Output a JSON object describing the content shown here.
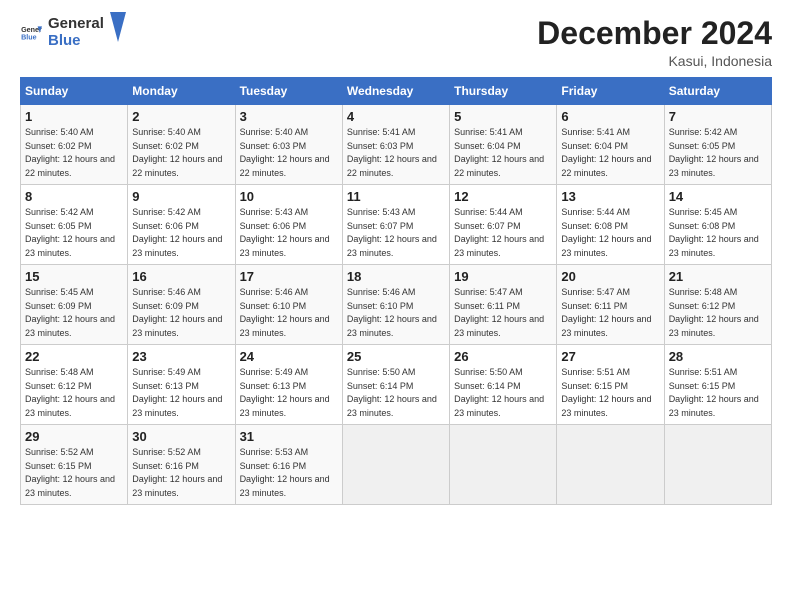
{
  "header": {
    "logo_general": "General",
    "logo_blue": "Blue",
    "title": "December 2024",
    "subtitle": "Kasui, Indonesia"
  },
  "calendar": {
    "days_of_week": [
      "Sunday",
      "Monday",
      "Tuesday",
      "Wednesday",
      "Thursday",
      "Friday",
      "Saturday"
    ],
    "weeks": [
      [
        {
          "day": "",
          "info": ""
        },
        {
          "day": "2",
          "sunrise": "Sunrise: 5:40 AM",
          "sunset": "Sunset: 6:02 PM",
          "daylight": "Daylight: 12 hours and 22 minutes."
        },
        {
          "day": "3",
          "sunrise": "Sunrise: 5:40 AM",
          "sunset": "Sunset: 6:03 PM",
          "daylight": "Daylight: 12 hours and 22 minutes."
        },
        {
          "day": "4",
          "sunrise": "Sunrise: 5:41 AM",
          "sunset": "Sunset: 6:03 PM",
          "daylight": "Daylight: 12 hours and 22 minutes."
        },
        {
          "day": "5",
          "sunrise": "Sunrise: 5:41 AM",
          "sunset": "Sunset: 6:04 PM",
          "daylight": "Daylight: 12 hours and 22 minutes."
        },
        {
          "day": "6",
          "sunrise": "Sunrise: 5:41 AM",
          "sunset": "Sunset: 6:04 PM",
          "daylight": "Daylight: 12 hours and 22 minutes."
        },
        {
          "day": "7",
          "sunrise": "Sunrise: 5:42 AM",
          "sunset": "Sunset: 6:05 PM",
          "daylight": "Daylight: 12 hours and 23 minutes."
        }
      ],
      [
        {
          "day": "8",
          "sunrise": "Sunrise: 5:42 AM",
          "sunset": "Sunset: 6:05 PM",
          "daylight": "Daylight: 12 hours and 23 minutes."
        },
        {
          "day": "9",
          "sunrise": "Sunrise: 5:42 AM",
          "sunset": "Sunset: 6:06 PM",
          "daylight": "Daylight: 12 hours and 23 minutes."
        },
        {
          "day": "10",
          "sunrise": "Sunrise: 5:43 AM",
          "sunset": "Sunset: 6:06 PM",
          "daylight": "Daylight: 12 hours and 23 minutes."
        },
        {
          "day": "11",
          "sunrise": "Sunrise: 5:43 AM",
          "sunset": "Sunset: 6:07 PM",
          "daylight": "Daylight: 12 hours and 23 minutes."
        },
        {
          "day": "12",
          "sunrise": "Sunrise: 5:44 AM",
          "sunset": "Sunset: 6:07 PM",
          "daylight": "Daylight: 12 hours and 23 minutes."
        },
        {
          "day": "13",
          "sunrise": "Sunrise: 5:44 AM",
          "sunset": "Sunset: 6:08 PM",
          "daylight": "Daylight: 12 hours and 23 minutes."
        },
        {
          "day": "14",
          "sunrise": "Sunrise: 5:45 AM",
          "sunset": "Sunset: 6:08 PM",
          "daylight": "Daylight: 12 hours and 23 minutes."
        }
      ],
      [
        {
          "day": "15",
          "sunrise": "Sunrise: 5:45 AM",
          "sunset": "Sunset: 6:09 PM",
          "daylight": "Daylight: 12 hours and 23 minutes."
        },
        {
          "day": "16",
          "sunrise": "Sunrise: 5:46 AM",
          "sunset": "Sunset: 6:09 PM",
          "daylight": "Daylight: 12 hours and 23 minutes."
        },
        {
          "day": "17",
          "sunrise": "Sunrise: 5:46 AM",
          "sunset": "Sunset: 6:10 PM",
          "daylight": "Daylight: 12 hours and 23 minutes."
        },
        {
          "day": "18",
          "sunrise": "Sunrise: 5:46 AM",
          "sunset": "Sunset: 6:10 PM",
          "daylight": "Daylight: 12 hours and 23 minutes."
        },
        {
          "day": "19",
          "sunrise": "Sunrise: 5:47 AM",
          "sunset": "Sunset: 6:11 PM",
          "daylight": "Daylight: 12 hours and 23 minutes."
        },
        {
          "day": "20",
          "sunrise": "Sunrise: 5:47 AM",
          "sunset": "Sunset: 6:11 PM",
          "daylight": "Daylight: 12 hours and 23 minutes."
        },
        {
          "day": "21",
          "sunrise": "Sunrise: 5:48 AM",
          "sunset": "Sunset: 6:12 PM",
          "daylight": "Daylight: 12 hours and 23 minutes."
        }
      ],
      [
        {
          "day": "22",
          "sunrise": "Sunrise: 5:48 AM",
          "sunset": "Sunset: 6:12 PM",
          "daylight": "Daylight: 12 hours and 23 minutes."
        },
        {
          "day": "23",
          "sunrise": "Sunrise: 5:49 AM",
          "sunset": "Sunset: 6:13 PM",
          "daylight": "Daylight: 12 hours and 23 minutes."
        },
        {
          "day": "24",
          "sunrise": "Sunrise: 5:49 AM",
          "sunset": "Sunset: 6:13 PM",
          "daylight": "Daylight: 12 hours and 23 minutes."
        },
        {
          "day": "25",
          "sunrise": "Sunrise: 5:50 AM",
          "sunset": "Sunset: 6:14 PM",
          "daylight": "Daylight: 12 hours and 23 minutes."
        },
        {
          "day": "26",
          "sunrise": "Sunrise: 5:50 AM",
          "sunset": "Sunset: 6:14 PM",
          "daylight": "Daylight: 12 hours and 23 minutes."
        },
        {
          "day": "27",
          "sunrise": "Sunrise: 5:51 AM",
          "sunset": "Sunset: 6:15 PM",
          "daylight": "Daylight: 12 hours and 23 minutes."
        },
        {
          "day": "28",
          "sunrise": "Sunrise: 5:51 AM",
          "sunset": "Sunset: 6:15 PM",
          "daylight": "Daylight: 12 hours and 23 minutes."
        }
      ],
      [
        {
          "day": "29",
          "sunrise": "Sunrise: 5:52 AM",
          "sunset": "Sunset: 6:15 PM",
          "daylight": "Daylight: 12 hours and 23 minutes."
        },
        {
          "day": "30",
          "sunrise": "Sunrise: 5:52 AM",
          "sunset": "Sunset: 6:16 PM",
          "daylight": "Daylight: 12 hours and 23 minutes."
        },
        {
          "day": "31",
          "sunrise": "Sunrise: 5:53 AM",
          "sunset": "Sunset: 6:16 PM",
          "daylight": "Daylight: 12 hours and 23 minutes."
        },
        {
          "day": "",
          "info": ""
        },
        {
          "day": "",
          "info": ""
        },
        {
          "day": "",
          "info": ""
        },
        {
          "day": "",
          "info": ""
        }
      ]
    ],
    "week1_sun": {
      "day": "1",
      "sunrise": "Sunrise: 5:40 AM",
      "sunset": "Sunset: 6:02 PM",
      "daylight": "Daylight: 12 hours and 22 minutes."
    }
  }
}
